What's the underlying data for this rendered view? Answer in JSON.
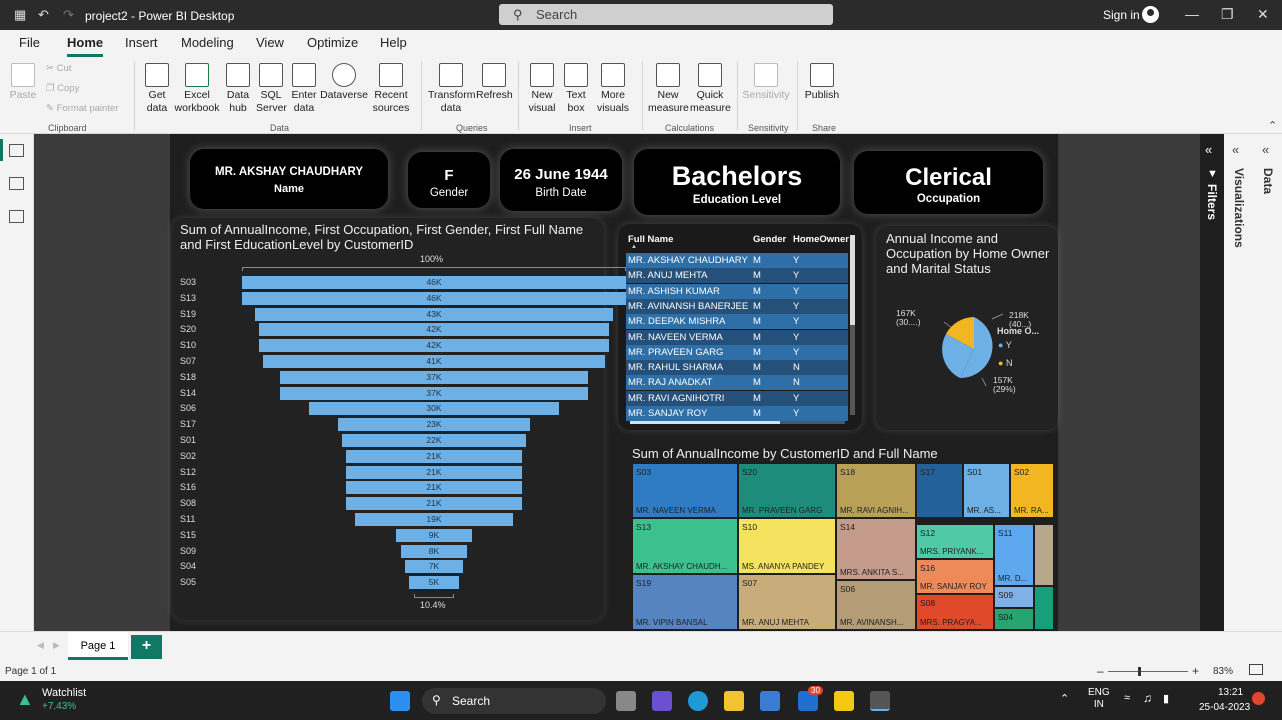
{
  "window": {
    "title": "project2 - Power BI Desktop",
    "search_placeholder": "Search",
    "signin": "Sign in"
  },
  "menu": [
    "File",
    "Home",
    "Insert",
    "Modeling",
    "View",
    "Optimize",
    "Help"
  ],
  "ribbon": {
    "clipboard": {
      "paste": "Paste",
      "cut": "Cut",
      "copy": "Copy",
      "format_painter": "Format painter",
      "group": "Clipboard"
    },
    "data": {
      "get_data": "Get data",
      "excel": "Excel workbook",
      "hub": "Data hub",
      "sql": "SQL Server",
      "enter": "Enter data",
      "dataverse": "Dataverse",
      "recent": "Recent sources",
      "group": "Data"
    },
    "queries": {
      "transform": "Transform data",
      "refresh": "Refresh",
      "group": "Queries"
    },
    "insert": {
      "visual": "New visual",
      "textbox": "Text box",
      "more": "More visuals",
      "group": "Insert"
    },
    "calc": {
      "measure": "New measure",
      "quick": "Quick measure",
      "group": "Calculations"
    },
    "sens": {
      "label": "Sensitivity",
      "group": "Sensitivity"
    },
    "share": {
      "publish": "Publish",
      "group": "Share"
    }
  },
  "cards": {
    "name": {
      "value": "MR. AKSHAY CHAUDHARY",
      "label": "Name"
    },
    "gender": {
      "value": "F",
      "label": "Gender"
    },
    "birth": {
      "value": "26 June 1944",
      "label": "Birth Date"
    },
    "edu": {
      "value": "Bachelors",
      "label": "Education Level"
    },
    "occ": {
      "value": "Clerical",
      "label": "Occupation"
    }
  },
  "funnel": {
    "title": "Sum of AnnualIncome, First Occupation, First Gender, First Full Name and First EducationLevel by CustomerID",
    "top_pct": "100%",
    "bottom_pct": "10.4%",
    "rows": [
      {
        "id": "S03",
        "value": 46,
        "label": "46K"
      },
      {
        "id": "S13",
        "value": 46,
        "label": "46K"
      },
      {
        "id": "S19",
        "value": 43,
        "label": "43K"
      },
      {
        "id": "S20",
        "value": 42,
        "label": "42K"
      },
      {
        "id": "S10",
        "value": 42,
        "label": "42K"
      },
      {
        "id": "S07",
        "value": 41,
        "label": "41K"
      },
      {
        "id": "S18",
        "value": 37,
        "label": "37K"
      },
      {
        "id": "S14",
        "value": 37,
        "label": "37K"
      },
      {
        "id": "S06",
        "value": 30,
        "label": "30K"
      },
      {
        "id": "S17",
        "value": 23,
        "label": "23K"
      },
      {
        "id": "S01",
        "value": 22,
        "label": "22K"
      },
      {
        "id": "S02",
        "value": 21,
        "label": "21K"
      },
      {
        "id": "S12",
        "value": 21,
        "label": "21K"
      },
      {
        "id": "S16",
        "value": 21,
        "label": "21K"
      },
      {
        "id": "S08",
        "value": 21,
        "label": "21K"
      },
      {
        "id": "S11",
        "value": 19,
        "label": "19K"
      },
      {
        "id": "S15",
        "value": 9,
        "label": "9K"
      },
      {
        "id": "S09",
        "value": 8,
        "label": "8K"
      },
      {
        "id": "S04",
        "value": 7,
        "label": "7K"
      },
      {
        "id": "S05",
        "value": 5,
        "label": "5K"
      }
    ]
  },
  "table": {
    "headers": [
      "Full Name",
      "Gender",
      "HomeOwner"
    ],
    "rows": [
      [
        "MR. AKSHAY CHAUDHARY",
        "M",
        "Y"
      ],
      [
        "MR. ANUJ MEHTA",
        "M",
        "Y"
      ],
      [
        "MR. ASHISH KUMAR",
        "M",
        "Y"
      ],
      [
        "MR. AVINANSH BANERJEE",
        "M",
        "Y"
      ],
      [
        "MR. DEEPAK MISHRA",
        "M",
        "Y"
      ],
      [
        "MR. NAVEEN VERMA",
        "M",
        "Y"
      ],
      [
        "MR. PRAVEEN GARG",
        "M",
        "Y"
      ],
      [
        "MR. RAHUL SHARMA",
        "M",
        "N"
      ],
      [
        "MR. RAJ ANADKAT",
        "M",
        "N"
      ],
      [
        "MR. RAVI AGNIHOTRI",
        "M",
        "Y"
      ],
      [
        "MR. SANJAY ROY",
        "M",
        "Y"
      ]
    ]
  },
  "pie": {
    "title": "Annual Income and Occupation by Home Owner and Marital Status",
    "legend_title": "Home O...",
    "labels": {
      "l1a": "167K",
      "l1b": "(30....)",
      "l2a": "218K",
      "l2b": "(40...)",
      "l3a": "157K",
      "l3b": "(29%)"
    },
    "legend": [
      {
        "name": "Y",
        "color": "#6db0e6"
      },
      {
        "name": "N",
        "color": "#f2b622"
      }
    ]
  },
  "treemap": {
    "title": "Sum of AnnualIncome by CustomerID and Full Name",
    "tiles": [
      {
        "id": "S03",
        "name": "MR. NAVEEN VERMA",
        "color": "#2f7bc4"
      },
      {
        "id": "S20",
        "name": "MR. PRAVEEN GARG",
        "color": "#1e8c7a"
      },
      {
        "id": "S18",
        "name": "MR. RAVI AGNIH...",
        "color": "#b8a057"
      },
      {
        "id": "S17",
        "name": "",
        "color": "#24609a"
      },
      {
        "id": "S01",
        "name": "MR. AS...",
        "color": "#6db0e6"
      },
      {
        "id": "S02",
        "name": "MR. RA...",
        "color": "#f2b622"
      },
      {
        "id": "S13",
        "name": "MR. AKSHAY CHAUDH...",
        "color": "#3cc08e"
      },
      {
        "id": "S10",
        "name": "MS. ANANYA PANDEY",
        "color": "#f5e25f"
      },
      {
        "id": "S14",
        "name": "MRS. ANKITA S...",
        "color": "#c59b8c"
      },
      {
        "id": "S12",
        "name": "MRS. PRIYANK...",
        "color": "#4fc9a8"
      },
      {
        "id": "S11",
        "name": "MR. D...",
        "color": "#5ea8f0"
      },
      {
        "id": "S16",
        "name": "MR. SANJAY ROY",
        "color": "#ee8a5a"
      },
      {
        "id": "S19",
        "name": "MR. VIPIN BANSAL",
        "color": "#5584c0"
      },
      {
        "id": "S07",
        "name": "MR. ANUJ MEHTA",
        "color": "#c8ad7a"
      },
      {
        "id": "S06",
        "name": "MR. AVINANSH...",
        "color": "#b49c76"
      },
      {
        "id": "S08",
        "name": "MRS. PRAGYA...",
        "color": "#e04a2a"
      },
      {
        "id": "S09",
        "name": "",
        "color": "#7fb0e8"
      },
      {
        "id": "S04",
        "name": "",
        "color": "#27a46f"
      }
    ]
  },
  "right_panes": {
    "filters": "Filters",
    "visualizations": "Visualizations",
    "data": "Data"
  },
  "pages": {
    "tab": "Page 1",
    "add": "+",
    "status": "Page 1 of 1",
    "zoom": "83%"
  },
  "taskbar": {
    "watch": "Watchlist",
    "watch_val": "+7.43%",
    "search": "Search",
    "lang1": "ENG",
    "lang2": "IN",
    "time": "13:21",
    "date": "25-04-2023",
    "badge": "30"
  }
}
